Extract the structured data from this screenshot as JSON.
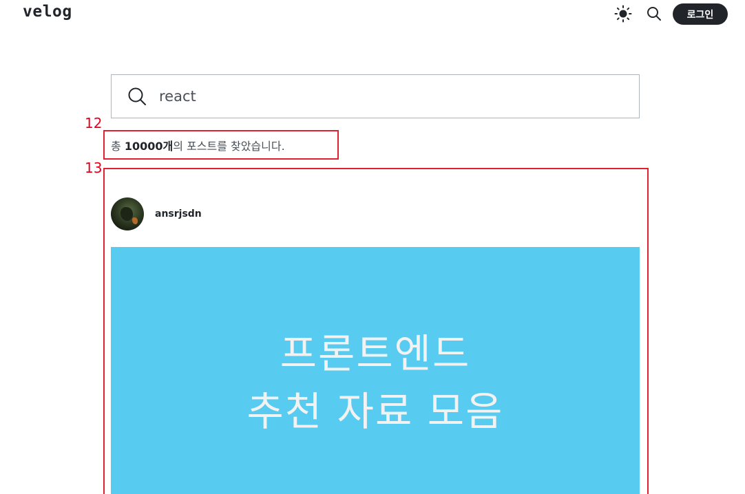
{
  "header": {
    "logo": "velog",
    "theme_toggle_icon": "sun-icon",
    "search_icon": "search-icon",
    "login_label": "로그인"
  },
  "search": {
    "value": "react",
    "icon": "search-icon"
  },
  "annotations": [
    {
      "label": "12"
    },
    {
      "label": "13"
    }
  ],
  "results": {
    "prefix": "총 ",
    "count": "10000개",
    "suffix": "의 포스트를 찾았습니다."
  },
  "post": {
    "username": "ansrjsdn",
    "thumbnail_line1": "프론트엔드",
    "thumbnail_line2": "추천 자료 모음",
    "thumbnail_color": "#57cbf0"
  },
  "colors": {
    "annotation": "#e0202e",
    "login_bg": "#212529"
  }
}
